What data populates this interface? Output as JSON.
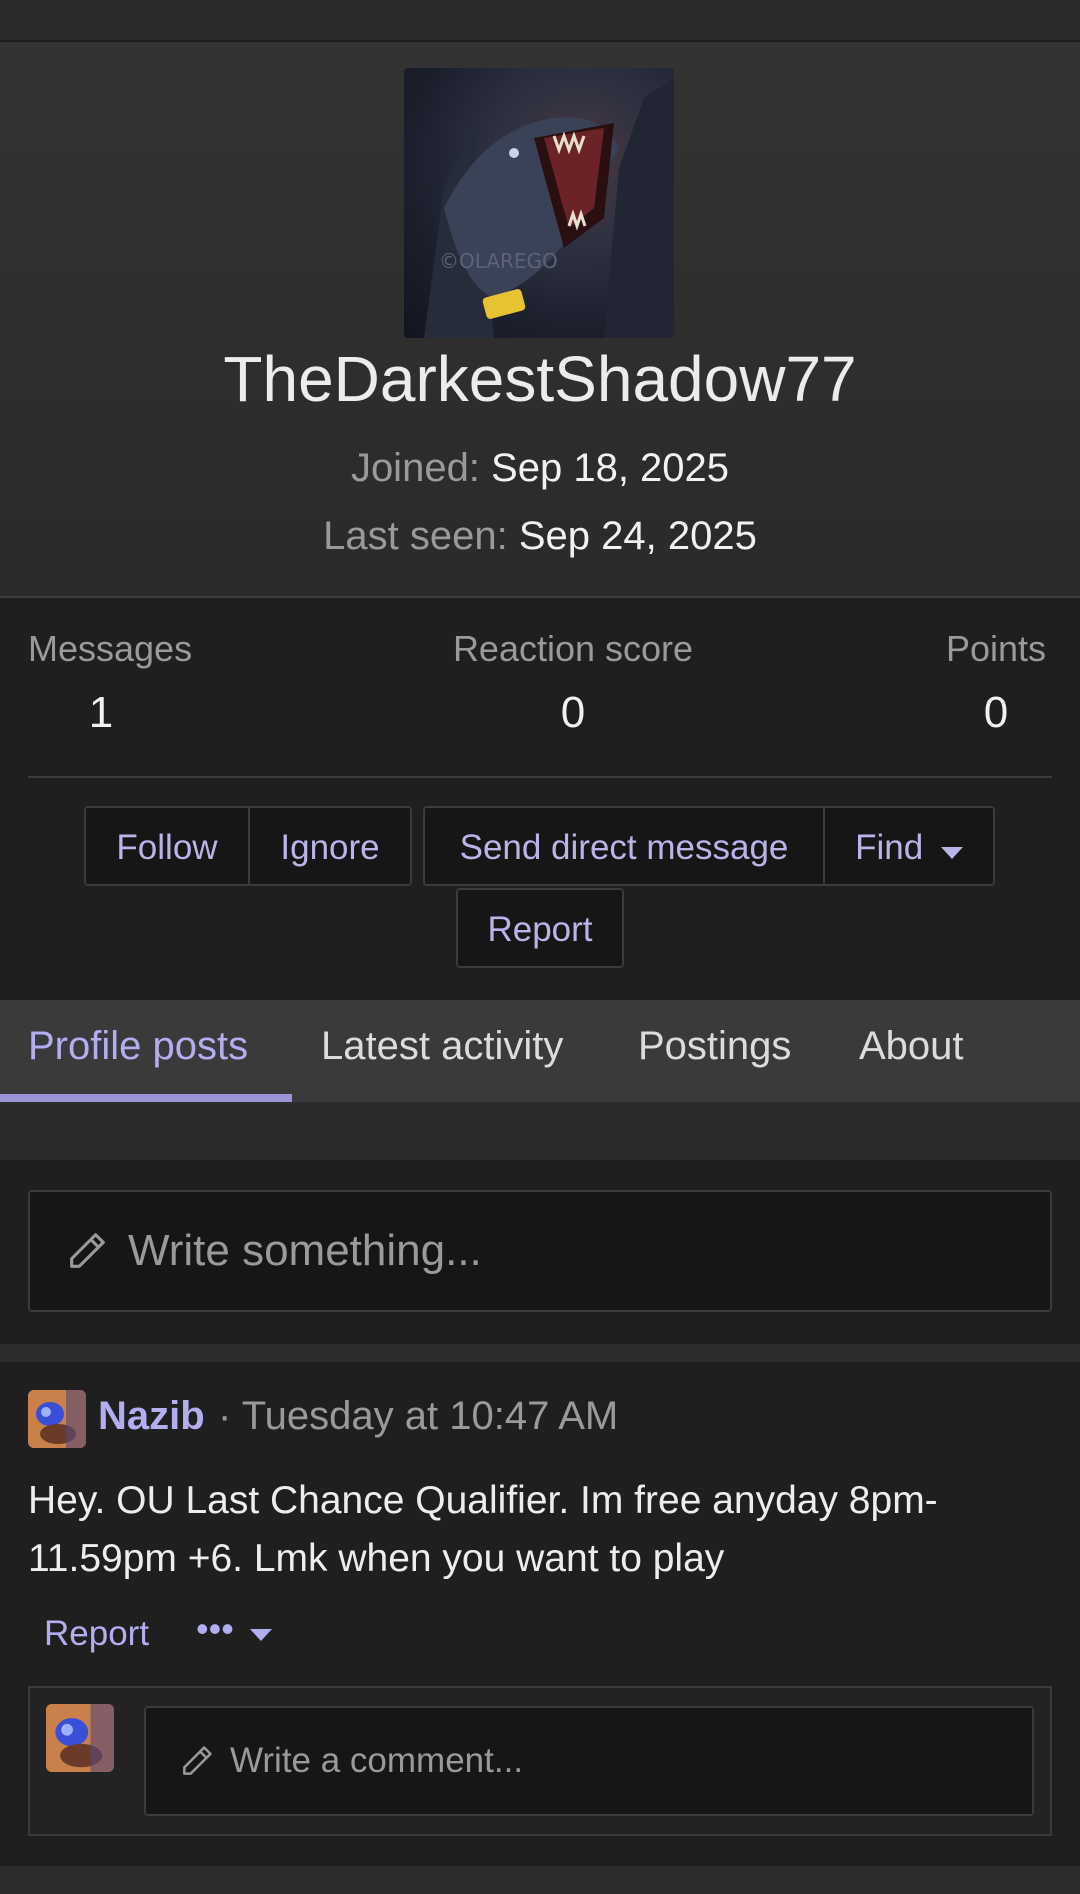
{
  "profile": {
    "username": "TheDarkestShadow77",
    "joined_label": "Joined:",
    "joined_value": "Sep 18, 2025",
    "last_seen_label": "Last seen:",
    "last_seen_value": "Sep 24, 2025",
    "avatar_watermark": "©OLAREGO"
  },
  "stats": [
    {
      "label": "Messages",
      "value": "1"
    },
    {
      "label": "Reaction score",
      "value": "0"
    },
    {
      "label": "Points",
      "value": "0"
    }
  ],
  "actions": {
    "follow": "Follow",
    "ignore": "Ignore",
    "send_dm": "Send direct message",
    "find": "Find",
    "report": "Report"
  },
  "tabs": [
    {
      "label": "Profile posts",
      "active": true
    },
    {
      "label": "Latest activity",
      "active": false
    },
    {
      "label": "Postings",
      "active": false
    },
    {
      "label": "About",
      "active": false
    }
  ],
  "write": {
    "placeholder": "Write something..."
  },
  "post": {
    "author": "Nazib",
    "time": "· Tuesday at 10:47 AM",
    "body": "Hey. OU Last Chance Qualifier. Im free anyday 8pm-11.59pm +6. Lmk when you want to play",
    "report": "Report",
    "more": "•••",
    "comment_placeholder": "Write a comment..."
  },
  "colors": {
    "accent": "#b3aef0",
    "background": "#1f1f1f",
    "tab_bar": "#3a3a3a"
  }
}
